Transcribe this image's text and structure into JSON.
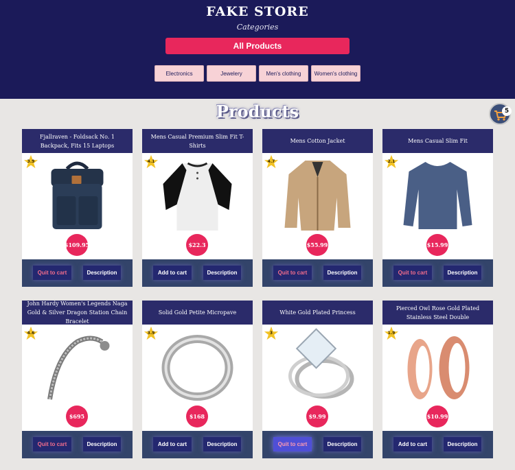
{
  "header": {
    "title": "FAKE STORE",
    "categories_label": "Categories",
    "all_products": "All Products",
    "categories": [
      "Electronics",
      "Jewelery",
      "Men's clothing",
      "Women's clothing"
    ]
  },
  "main": {
    "title": "Products",
    "cart_count": "5",
    "colors": {
      "header_bg": "#1b1a59",
      "accent": "#e8275c",
      "card_head": "#2b2b6a",
      "star": "#f2c224"
    },
    "products": [
      {
        "title": "Fjallraven - Foldsack No. 1 Backpack, Fits 15 Laptops",
        "rating": "3.9",
        "price": "$109.95",
        "action": "Quit to cart",
        "desc": "Description",
        "icon": "backpack-image"
      },
      {
        "title": "Mens Casual Premium Slim Fit T-Shirts",
        "rating": "4.1",
        "price": "$22.3",
        "action": "Add to cart",
        "desc": "Description",
        "icon": "tshirt-image"
      },
      {
        "title": "Mens Cotton Jacket",
        "rating": "4.7",
        "price": "$55.99",
        "action": "Quit to cart",
        "desc": "Description",
        "icon": "jacket-image"
      },
      {
        "title": "Mens Casual Slim Fit",
        "rating": "2.1",
        "price": "$15.99",
        "action": "Quit to cart",
        "desc": "Description",
        "icon": "longsleeve-image"
      },
      {
        "title": "John Hardy Women's Legends Naga Gold & Silver Dragon Station Chain Bracelet",
        "rating": "4.6",
        "price": "$695",
        "action": "Quit to cart",
        "desc": "Description",
        "icon": "bracelet-image"
      },
      {
        "title": "Solid Gold Petite Micropave",
        "rating": "3.9",
        "price": "$168",
        "action": "Add to cart",
        "desc": "Description",
        "icon": "ring-image"
      },
      {
        "title": "White Gold Plated Princess",
        "rating": "3",
        "price": "$9.99",
        "action": "Quit to cart",
        "desc": "Description",
        "icon": "diamond-ring-image"
      },
      {
        "title": "Pierced Owl Rose Gold Plated Stainless Steel Double",
        "rating": "1.9",
        "price": "$10.99",
        "action": "Add to cart",
        "desc": "Description",
        "icon": "earrings-image"
      }
    ]
  }
}
